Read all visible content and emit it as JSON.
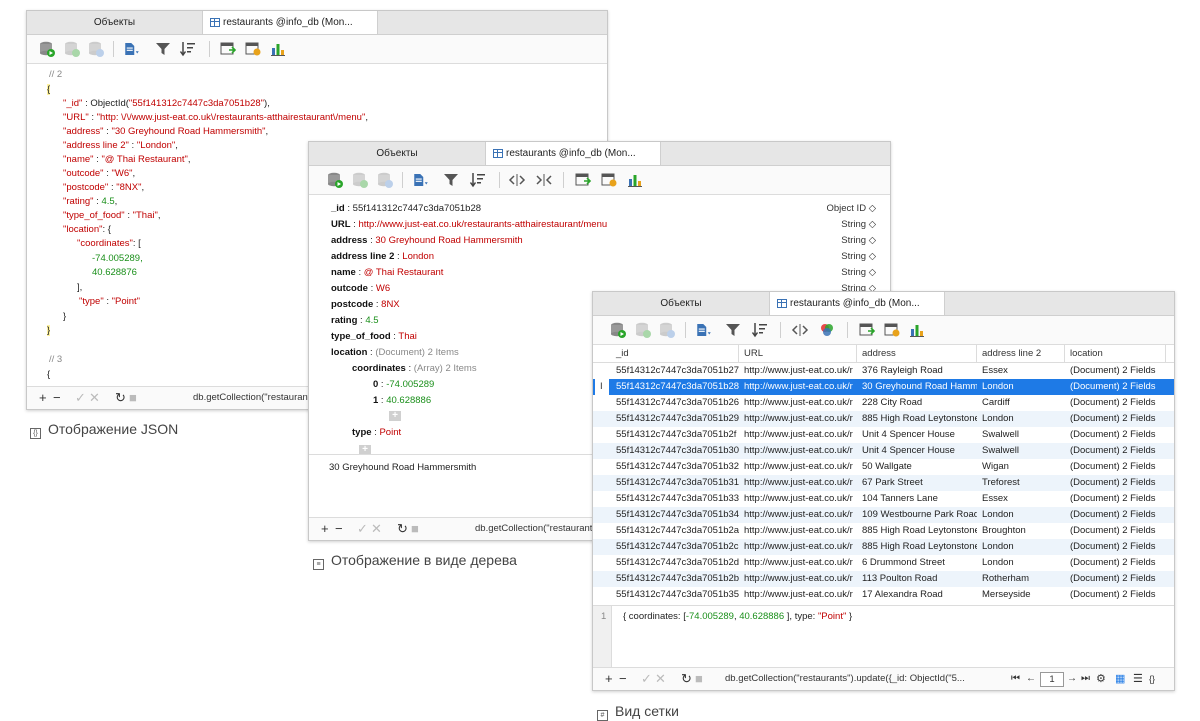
{
  "json_view": {
    "tabs": {
      "objects": "Объекты",
      "collection": "restaurants @info_db (Mon..."
    },
    "lines": {
      "c2": "// 2",
      "open": "{",
      "id_k": "\"_id\"",
      "id_fn": "ObjectId(",
      "id_v": "\"55f141312c7447c3da7051b28\"",
      "id_close": "),",
      "url_k": "\"URL\"",
      "url_v": "\"http: \\/\\/www.just-eat.co.uk\\/restaurants-atthairestaurant\\/menu\"",
      "addr_k": "\"address\"",
      "addr_v": "\"30 Greyhound Road Hammersmith\"",
      "addr2_k": "\"address line 2\"",
      "addr2_v": "\"London\"",
      "name_k": "\"name\"",
      "name_v": "\"@ Thai Restaurant\"",
      "out_k": "\"outcode\"",
      "out_v": "\"W6\"",
      "post_k": "\"postcode\"",
      "post_v": "\"8NX\"",
      "rat_k": "\"rating\"",
      "rat_v": "4.5",
      "food_k": "\"type_of_food\"",
      "food_v": "\"Thai\"",
      "loc_k": "\"location\"",
      "loc_open": ": {",
      "coord_k": "\"coordinates\"",
      "coord_open": ": [",
      "c1": "-74.005289,",
      "c2v": "40.628876",
      "arr_close": "],",
      "type_k": "\"type\"",
      "type_v": "\"Point\"",
      "inner_close": "}",
      "close": "}",
      "c3": "// 3",
      "open3": "{"
    },
    "query": "db.getCollection(\"restaurant",
    "caption": "Отображение JSON"
  },
  "tree_view": {
    "tabs": {
      "objects": "Объекты",
      "collection": "restaurants @info_db (Mon..."
    },
    "rows": [
      {
        "key": "_id",
        "value": "55f141312c7447c3da7051b28",
        "type": "Object ID ◇"
      },
      {
        "key": "URL",
        "value": "http://www.just-eat.co.uk/restaurants-atthairestaurant/menu",
        "type": "String ◇"
      },
      {
        "key": "address",
        "value": "30 Greyhound Road Hammersmith",
        "type": "String ◇"
      },
      {
        "key": "address line 2",
        "value": "London",
        "type": "String ◇"
      },
      {
        "key": "name",
        "value": "@ Thai Restaurant",
        "type": "String ◇"
      },
      {
        "key": "outcode",
        "value": "W6",
        "type": "String ◇"
      },
      {
        "key": "postcode",
        "value": "8NX",
        "type": ""
      },
      {
        "key": "rating",
        "value": "4.5",
        "type": ""
      },
      {
        "key": "type_of_food",
        "value": "Thai",
        "type": ""
      }
    ],
    "location_key": "location",
    "location_value": "(Document) 2 Items",
    "coords_key": "coordinates",
    "coords_value": "(Array) 2 Items",
    "coord0_key": "0",
    "coord0_value": "-74.005289",
    "coord1_key": "1",
    "coord1_value": "40.628886",
    "type_key": "type",
    "type_value": "Point",
    "editor_value": "30 Greyhound Road Hammersmith",
    "query": "db.getCollection(\"restaurant",
    "caption": "Отображение в виде дерева"
  },
  "grid_view": {
    "tabs": {
      "objects": "Объекты",
      "collection": "restaurants @info_db (Mon..."
    },
    "columns": [
      "_id",
      "URL",
      "address",
      "address line 2",
      "location"
    ],
    "rows": [
      [
        "55f14312c7447c3da7051b27",
        "http://www.just-eat.co.uk/r",
        "376 Rayleigh Road",
        "Essex",
        "(Document) 2 Fields"
      ],
      [
        "55f14312c7447c3da7051b28",
        "http://www.just-eat.co.uk/r",
        "30 Greyhound Road Hamm",
        "London",
        "(Document) 2 Fields"
      ],
      [
        "55f14312c7447c3da7051b26",
        "http://www.just-eat.co.uk/r",
        "228 City Road",
        "Cardiff",
        "(Document) 2 Fields"
      ],
      [
        "55f14312c7447c3da7051b29",
        "http://www.just-eat.co.uk/r",
        "885 High Road Leytonstone",
        "London",
        "(Document) 2 Fields"
      ],
      [
        "55f14312c7447c3da7051b2f",
        "http://www.just-eat.co.uk/r",
        "Unit 4 Spencer House",
        "Swalwell",
        "(Document) 2 Fields"
      ],
      [
        "55f14312c7447c3da7051b30",
        "http://www.just-eat.co.uk/r",
        "Unit 4 Spencer House",
        "Swalwell",
        "(Document) 2 Fields"
      ],
      [
        "55f14312c7447c3da7051b32",
        "http://www.just-eat.co.uk/r",
        "50 Wallgate",
        "Wigan",
        "(Document) 2 Fields"
      ],
      [
        "55f14312c7447c3da7051b31",
        "http://www.just-eat.co.uk/r",
        "67 Park Street",
        "Treforest",
        "(Document) 2 Fields"
      ],
      [
        "55f14312c7447c3da7051b33",
        "http://www.just-eat.co.uk/r",
        "104 Tanners Lane",
        "Essex",
        "(Document) 2 Fields"
      ],
      [
        "55f14312c7447c3da7051b34",
        "http://www.just-eat.co.uk/r",
        "109 Westbourne Park Road",
        "London",
        "(Document) 2 Fields"
      ],
      [
        "55f14312c7447c3da7051b2a",
        "http://www.just-eat.co.uk/r",
        "885 High Road Leytonstone",
        "Broughton",
        "(Document) 2 Fields"
      ],
      [
        "55f14312c7447c3da7051b2c",
        "http://www.just-eat.co.uk/r",
        "885 High Road Leytonstone",
        "London",
        "(Document) 2 Fields"
      ],
      [
        "55f14312c7447c3da7051b2d",
        "http://www.just-eat.co.uk/r",
        "6 Drummond Street",
        "London",
        "(Document) 2 Fields"
      ],
      [
        "55f14312c7447c3da7051b2b",
        "http://www.just-eat.co.uk/r",
        "113 Poulton Road",
        "Rotherham",
        "(Document) 2 Fields"
      ],
      [
        "55f14312c7447c3da7051b35",
        "http://www.just-eat.co.uk/r",
        "17 Alexandra Road",
        "Merseyside",
        "(Document) 2 Fields"
      ]
    ],
    "editor_line_no": "1",
    "editor_pre": "{ coordinates: [",
    "editor_n1": "-74.005289",
    "editor_comma": ", ",
    "editor_n2": "40.628886",
    "editor_mid": " ], type: ",
    "editor_str": "\"Point\"",
    "editor_end": " }",
    "query": "db.getCollection(\"restaurants\").update({_id: ObjectId(\"5...",
    "page": "1",
    "caption": "Вид сетки"
  }
}
